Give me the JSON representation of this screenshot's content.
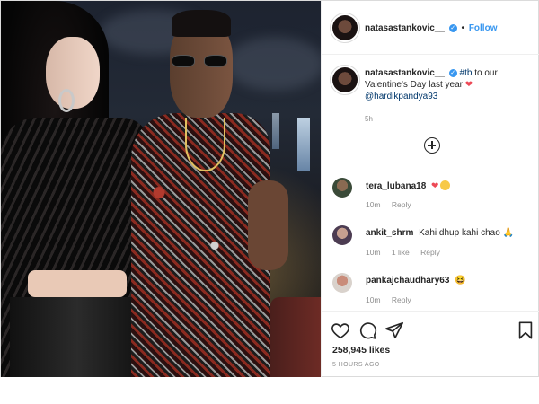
{
  "post": {
    "author": {
      "username": "natasastankovic__",
      "verified_symbol": "✓",
      "follow_separator": "•",
      "follow_label": "Follow"
    },
    "caption": {
      "username": "natasastankovic__",
      "hashtag": "#tb",
      "text_part1": " to our Valentine's Day last year ",
      "heart_emoji": "❤",
      "mention": "@hardikpandya93",
      "time": "5h"
    },
    "load_more_icon": "plus-circle-icon",
    "comments": [
      {
        "username": "tera_lubana18",
        "text": "",
        "emojis": [
          "heart",
          "flushed-face"
        ],
        "heart_glyph": "❤",
        "time": "10m",
        "likes": "",
        "reply_label": "Reply"
      },
      {
        "username": "ankit_shrm",
        "text": "Kahi dhup kahi chao",
        "emoji_glyph": "🙏",
        "time": "10m",
        "likes": "1 like",
        "reply_label": "Reply"
      },
      {
        "username": "pankajchaudhary63",
        "text": "",
        "emoji_glyph": "😆",
        "time": "10m",
        "likes": "",
        "reply_label": "Reply"
      }
    ],
    "actions": {
      "like_icon": "heart-outline-icon",
      "comment_icon": "comment-bubble-icon",
      "share_icon": "paper-plane-icon",
      "save_icon": "bookmark-icon"
    },
    "likes": "258,945 likes",
    "posted": "5 HOURS AGO"
  },
  "colors": {
    "link_blue": "#3897f0",
    "mention_blue": "#00376b",
    "muted_gray": "#8e8e8e",
    "heart_red": "#ed4956",
    "border": "#dbdbdb"
  }
}
